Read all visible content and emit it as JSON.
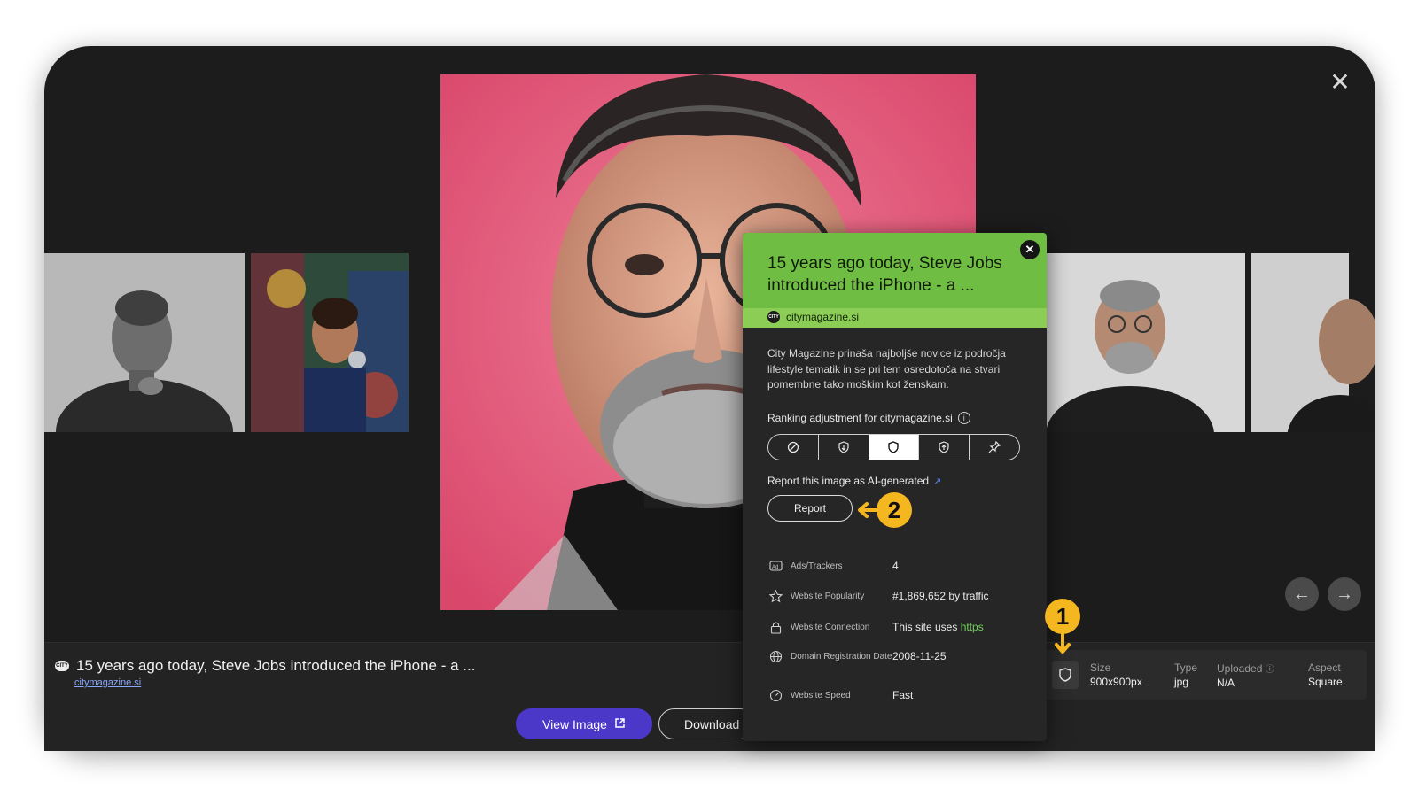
{
  "viewer": {
    "close_icon": "close-icon"
  },
  "main_image": {
    "subject": "Steve Jobs portrait"
  },
  "caption": {
    "logo_text": "CITY",
    "title": "15 years ago today, Steve Jobs introduced the iPhone - a ...",
    "site": "citymagazine.si"
  },
  "buttons": {
    "view_image": "View Image",
    "download": "Download"
  },
  "meta": {
    "size_label": "Size",
    "size_value": "900x900px",
    "type_label": "Type",
    "type_value": "jpg",
    "uploaded_label": "Uploaded",
    "uploaded_value": "N/A",
    "aspect_label": "Aspect",
    "aspect_value": "Square"
  },
  "popup": {
    "title": "15 years ago today, Steve Jobs introduced the iPhone - a ...",
    "site": "citymagazine.si",
    "description": "City Magazine prinaša najboljše novice iz področja lifestyle tematik in se pri tem osredotoča na stvari pomembne tako moškim kot ženskam.",
    "ranking_label": "Ranking adjustment for citymagazine.si",
    "ranking_options": [
      "block",
      "lower",
      "normal",
      "raise",
      "pin"
    ],
    "ranking_selected": "normal",
    "ai_report_label": "Report this image as AI-generated",
    "report_button": "Report",
    "info": [
      {
        "label": "Ads/Trackers",
        "value": "4"
      },
      {
        "label": "Website Popularity",
        "value": "#1,869,652 by traffic"
      },
      {
        "label": "Website Connection",
        "value": "This site uses",
        "value_accent": "https"
      },
      {
        "label": "Domain Registration Date",
        "value": "2008-11-25"
      },
      {
        "label": "Website Speed",
        "value": "Fast"
      }
    ]
  },
  "annotations": {
    "marker_1": "1",
    "marker_2": "2",
    "color": "#f4b720"
  },
  "colors": {
    "popup_header": "#6fbe43",
    "primary_button": "#4b37c8",
    "background": "#1c1c1c"
  }
}
